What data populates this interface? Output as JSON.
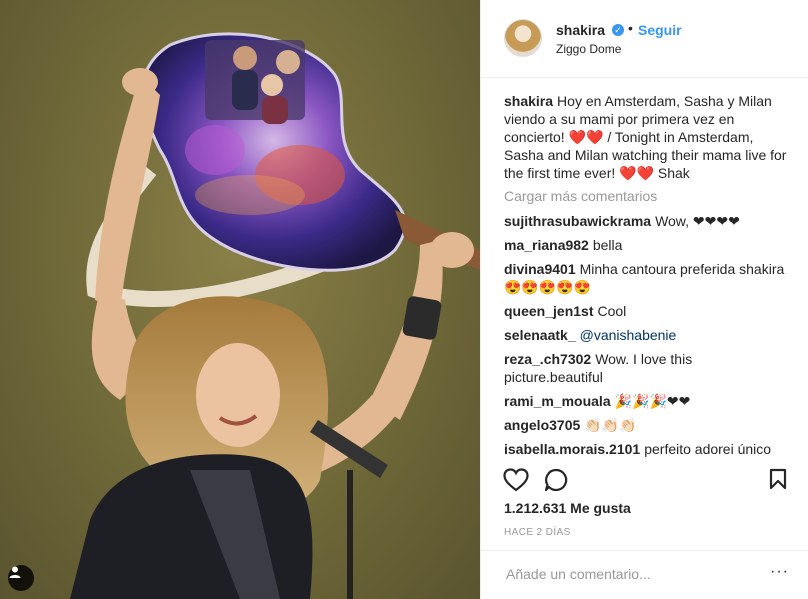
{
  "post": {
    "username": "shakira",
    "follow_label": "Seguir",
    "dot": "•",
    "location": "Ziggo Dome",
    "verified_icon": "verified-badge-icon",
    "caption_user": "shakira",
    "caption_text": "Hoy en Amsterdam, Sasha y Milan viendo a su mami por primera vez en concierto! ❤️❤️ / Tonight in Amsterdam, Sasha and Milan watching their mama live for the first time ever! ❤️❤️ Shak",
    "load_more": "Cargar más comentarios",
    "likes": "1.212.631 Me gusta",
    "timestamp": "HACE 2 DÍAS",
    "add_comment_placeholder": "Añade un comentario...",
    "options_label": "···"
  },
  "comments": [
    {
      "user": "sujithrasubawickrama",
      "text": "Wow, ❤❤❤❤"
    },
    {
      "user": "ma_riana982",
      "text": "bella"
    },
    {
      "user": "divina9401",
      "text": "Minha cantoura preferida shakira😍😍😍😍😍"
    },
    {
      "user": "queen_jen1st",
      "text": "Cool"
    },
    {
      "user": "selenaatk_",
      "text": "",
      "mention": "@vanishabenie"
    },
    {
      "user": "reza_.ch7302",
      "text": "Wow. I love this picture.beautiful"
    },
    {
      "user": "rami_m_mouala",
      "text": "🎉🎉🎉❤❤"
    },
    {
      "user": "angelo3705",
      "text": "👏🏻👏🏻👏🏻"
    },
    {
      "user": "isabella.morais.2101",
      "text": "perfeito adorei único"
    }
  ],
  "colors": {
    "link": "#3897f0",
    "mention": "#003569",
    "muted": "#999999",
    "border": "#efefef",
    "photo_bg": "#6f6838"
  },
  "icons": {
    "like": "heart-icon",
    "comment": "comment-bubble-icon",
    "save": "bookmark-icon",
    "tag": "user-tag-icon"
  }
}
